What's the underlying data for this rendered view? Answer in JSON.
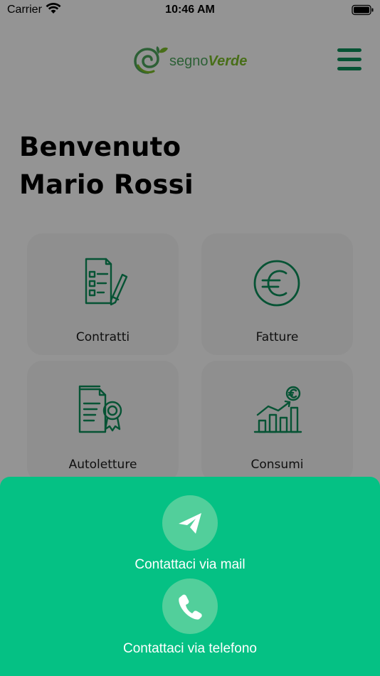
{
  "status_bar": {
    "carrier": "Carrier",
    "time": "10:46 AM"
  },
  "header": {
    "logo_segno": "segno",
    "logo_verde": "Verde",
    "menu_icon": "hamburger-menu-icon"
  },
  "welcome": {
    "line1": "Benvenuto",
    "line2": "Mario Rossi"
  },
  "menu_cards": [
    {
      "label": "Contratti",
      "icon": "contract-document-icon"
    },
    {
      "label": "Fatture",
      "icon": "euro-circle-icon"
    },
    {
      "label": "Autoletture",
      "icon": "certificate-document-icon"
    },
    {
      "label": "Consumi",
      "icon": "bar-chart-euro-icon"
    }
  ],
  "contact_sheet": {
    "mail_label": "Contattaci via mail",
    "mail_icon": "paper-plane-icon",
    "phone_label": "Contattaci via telefono",
    "phone_icon": "phone-icon"
  },
  "colors": {
    "accent_green": "#0b8a58",
    "sheet_green": "#05c184",
    "logo_green": "#79b829"
  }
}
